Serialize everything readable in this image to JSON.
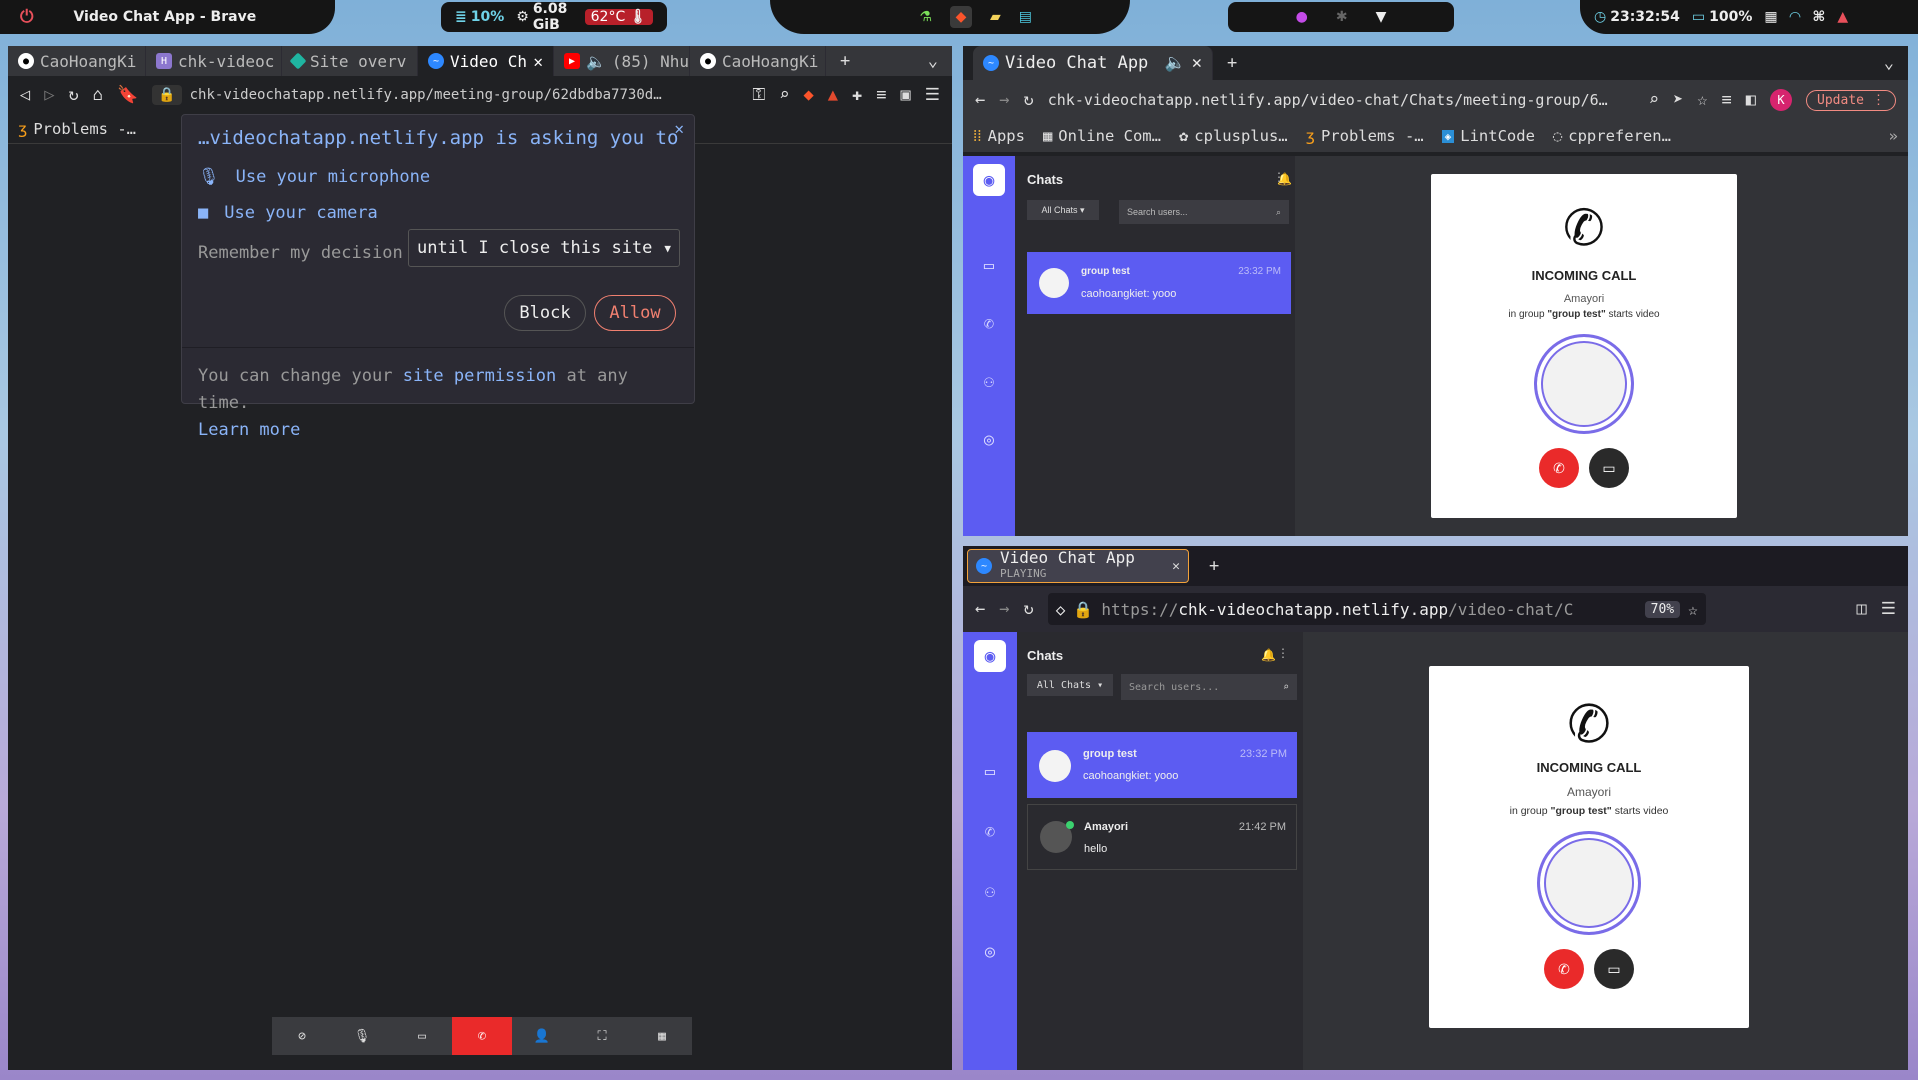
{
  "topbar": {
    "window_title": "Video Chat App - Brave",
    "cpu": "10%",
    "ram": "6.08 GiB",
    "temp": "62°C",
    "time": "23:32:54",
    "battery": "100%"
  },
  "left": {
    "tabs": [
      "CaoHoangKi",
      "chk-videoc",
      "Site overv",
      "Video Ch",
      "(85) Nhu",
      "CaoHoangKi"
    ],
    "url": "chk-videochatapp.netlify.app/meeting-group/62dbdba7730d…",
    "bookmark": "Problems -…",
    "popup": {
      "title": "…videochatapp.netlify.app is asking you to",
      "mic": "Use your microphone",
      "cam": "Use your camera",
      "remember": "Remember my decision",
      "select": "until I close this site",
      "block": "Block",
      "allow": "Allow",
      "footer_a": "You can change your ",
      "footer_link": "site permission",
      "footer_b": " at any time.",
      "learn": "Learn more"
    }
  },
  "tr": {
    "tab": "Video Chat App",
    "url": "chk-videochatapp.netlify.app/video-chat/Chats/meeting-group/6…",
    "update": "Update",
    "avatar": "K",
    "bookmarks": [
      "Apps",
      "Online Com…",
      "cplusplus…",
      "Problems -…",
      "LintCode",
      "cppreferen…"
    ],
    "chats_title": "Chats",
    "filter": "All Chats",
    "search_ph": "Search users...",
    "chat": {
      "name": "group test",
      "time": "23:32 PM",
      "msg": "caohoangkiet: yooo"
    },
    "call": {
      "title": "INCOMING CALL",
      "caller": "Amayori",
      "pre": "in group ",
      "group": "\"group test\"",
      "post": " starts video"
    }
  },
  "br": {
    "tab": "Video Chat App",
    "tab_sub": "PLAYING",
    "url_pre": "https://",
    "url_dom": "chk-videochatapp.netlify.app",
    "url_post": "/video-chat/C",
    "zoom": "70%",
    "chats_title": "Chats",
    "filter": "All Chats",
    "search_ph": "Search users...",
    "chat1": {
      "name": "group test",
      "time": "23:32 PM",
      "msg": "caohoangkiet: yooo"
    },
    "chat2": {
      "name": "Amayori",
      "time": "21:42 PM",
      "msg": "hello"
    },
    "call": {
      "title": "INCOMING CALL",
      "caller": "Amayori",
      "pre": "in group ",
      "group": "\"group test\"",
      "post": " starts video"
    }
  },
  "colors": {
    "accent": "#5c5cf2",
    "danger": "#ea2a2a",
    "link": "#8ab4f8"
  }
}
